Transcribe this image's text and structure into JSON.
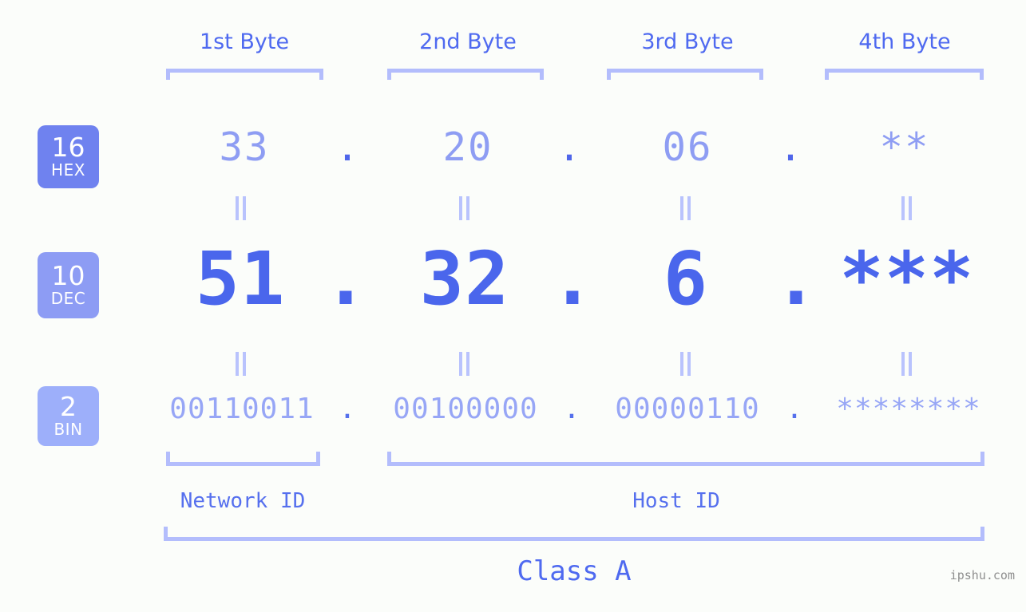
{
  "theme": {
    "background": "#fbfdfa",
    "bracket": "#b3bdfc",
    "header_text": "#4f6af0",
    "hex_color": "#8e9df3",
    "dec_color": "#4a66ec",
    "bin_color": "#97a6f6",
    "separator_color": "#4f66ea",
    "equals_color": "#b9c3fd",
    "badge_hex_bg": "#6f82ef",
    "badge_dec_bg": "#8d9cf4",
    "badge_bin_bg": "#9daffa",
    "watermark_color": "#8f8f8f"
  },
  "headers": [
    {
      "label": "1st Byte"
    },
    {
      "label": "2nd Byte"
    },
    {
      "label": "3rd Byte"
    },
    {
      "label": "4th Byte"
    }
  ],
  "radix_badges": [
    {
      "number": "16",
      "name": "HEX"
    },
    {
      "number": "10",
      "name": "DEC"
    },
    {
      "number": "2",
      "name": "BIN"
    }
  ],
  "rows": {
    "hex": {
      "radix": "16",
      "radix_name": "HEX",
      "bytes": [
        "33",
        "20",
        "06",
        "**"
      ],
      "separators": [
        ".",
        ".",
        "."
      ]
    },
    "dec": {
      "radix": "10",
      "radix_name": "DEC",
      "bytes": [
        "51",
        "32",
        "6",
        "***"
      ],
      "separators": [
        ".",
        ".",
        "."
      ]
    },
    "bin": {
      "radix": "2",
      "radix_name": "BIN",
      "bytes": [
        "00110011",
        "00100000",
        "00000110",
        "********"
      ],
      "separators": [
        ".",
        ".",
        "."
      ]
    }
  },
  "equals_marks": {
    "symbol": "=",
    "count_per_gap": 4,
    "gaps": [
      "hex-to-dec",
      "dec-to-bin"
    ]
  },
  "segments": {
    "network_id": "Network ID",
    "host_id": "Host ID"
  },
  "class_label": "Class A",
  "watermark": "ipshu.com"
}
